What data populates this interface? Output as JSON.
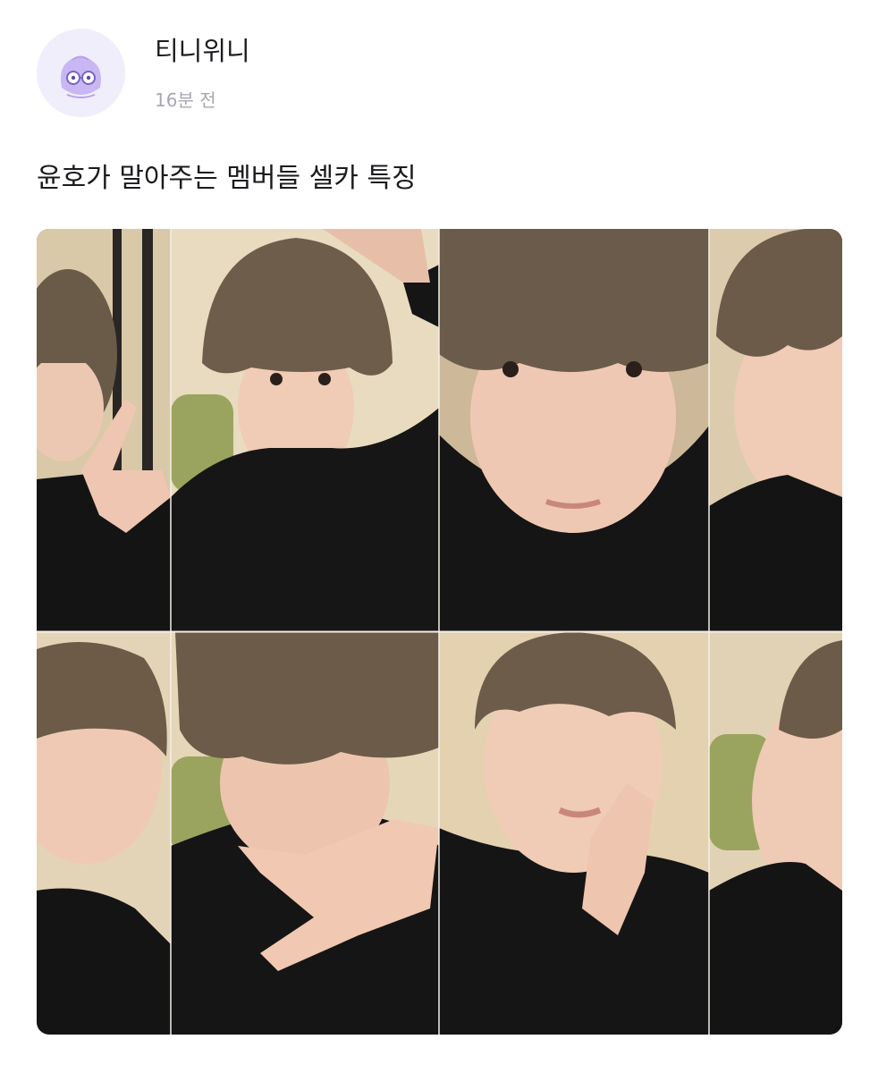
{
  "post": {
    "author": "티니위니",
    "time": "16분 전",
    "title": "윤호가 말아주는 멤버들 셀카 특징"
  },
  "icons": {
    "avatar": "profile-avatar-icon"
  },
  "colors": {
    "avatar_bg": "#f1eefc",
    "avatar_mascot": "#c7b4f2",
    "timestamp": "#a7a7b3",
    "text": "#1b1b1f"
  }
}
